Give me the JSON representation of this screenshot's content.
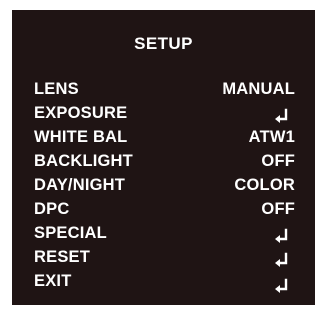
{
  "menu": {
    "title": "SETUP",
    "items": [
      {
        "label": "LENS",
        "value": "MANUAL",
        "icon": null
      },
      {
        "label": "EXPOSURE",
        "value": null,
        "icon": "enter-arrow-icon"
      },
      {
        "label": "WHITE BAL",
        "value": "ATW1",
        "icon": null
      },
      {
        "label": "BACKLIGHT",
        "value": "OFF",
        "icon": null
      },
      {
        "label": "DAY/NIGHT",
        "value": "COLOR",
        "icon": null
      },
      {
        "label": "DPC",
        "value": "OFF",
        "icon": null
      },
      {
        "label": "SPECIAL",
        "value": null,
        "icon": "enter-arrow-icon"
      },
      {
        "label": "RESET",
        "value": null,
        "icon": "enter-arrow-icon"
      },
      {
        "label": "EXIT",
        "value": null,
        "icon": "enter-arrow-icon"
      }
    ]
  },
  "colors": {
    "background": "#1f1414",
    "text": "#ffffff"
  }
}
